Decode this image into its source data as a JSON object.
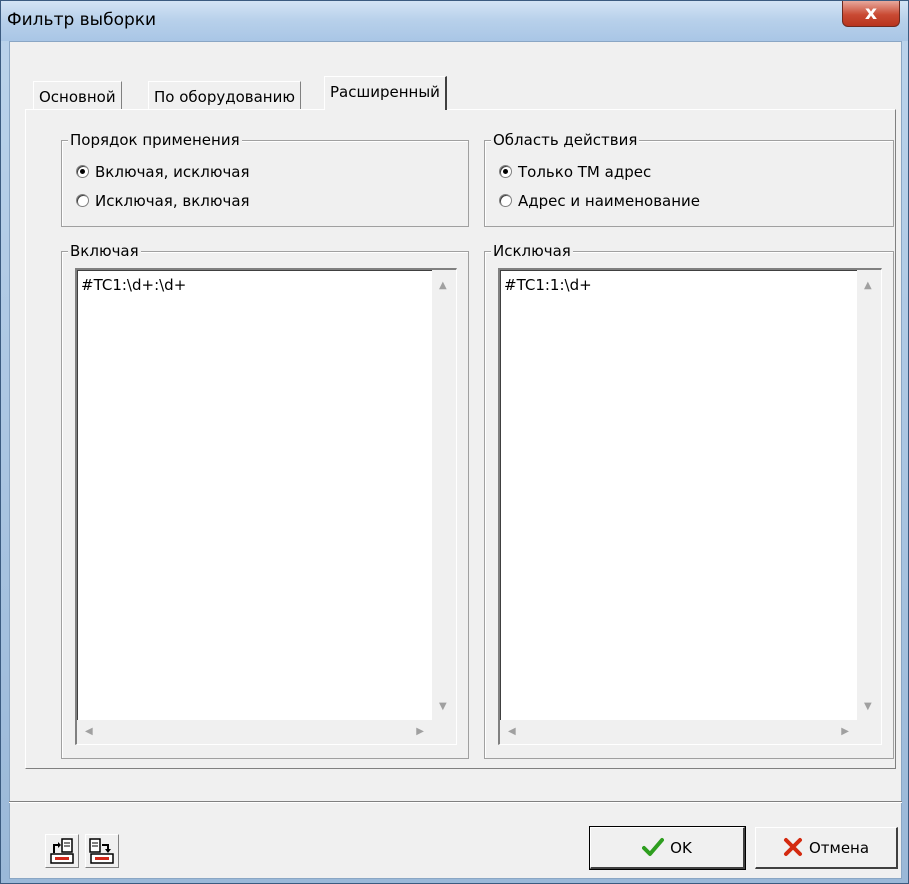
{
  "window": {
    "title": "Фильтр выборки",
    "close_label": "x"
  },
  "tabs": [
    {
      "label": "Основной",
      "active": false
    },
    {
      "label": "По оборудованию",
      "active": false
    },
    {
      "label": "Расширенный",
      "active": true
    }
  ],
  "order_group": {
    "title": "Порядок применения",
    "options": [
      {
        "label": "Включая, исключая",
        "checked": true
      },
      {
        "label": "Исключая, включая",
        "checked": false
      }
    ]
  },
  "scope_group": {
    "title": "Область действия",
    "options": [
      {
        "label": "Только ТМ адрес",
        "checked": true
      },
      {
        "label": "Адрес и наименование",
        "checked": false
      }
    ]
  },
  "include_group": {
    "title": "Включая",
    "text": "#TC1:\\d+:\\d+"
  },
  "exclude_group": {
    "title": "Исключая",
    "text": "#TC1:1:\\d+"
  },
  "buttons": {
    "ok": "OK",
    "cancel": "Отмена"
  },
  "toolbar": {
    "import_icon": "import-icon",
    "export_icon": "export-icon"
  },
  "colors": {
    "ok_check": "#2e9e1f",
    "cancel_x": "#d42a10"
  }
}
